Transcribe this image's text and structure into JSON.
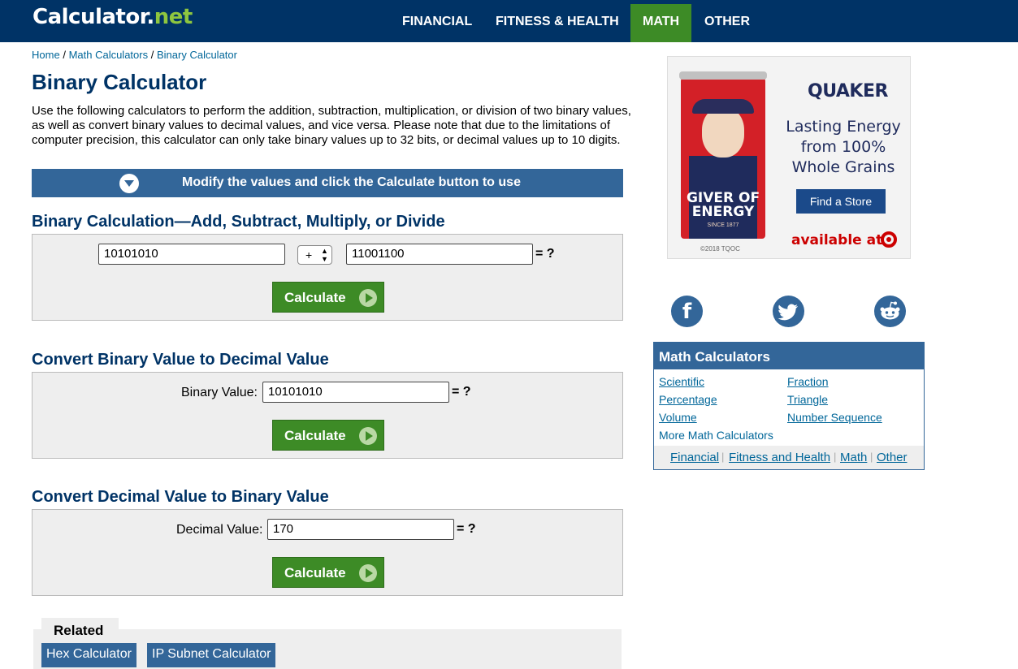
{
  "header": {
    "logo_main": "Calculator",
    "logo_dot": ".",
    "logo_net": "net",
    "nav": [
      "FINANCIAL",
      "FITNESS & HEALTH",
      "MATH",
      "OTHER"
    ],
    "active_nav": "MATH",
    "colors": {
      "bar": "#003366",
      "active": "#3d8b26"
    }
  },
  "breadcrumb": [
    "Home",
    "Math Calculators",
    "Binary Calculator"
  ],
  "breadcrumb_sep": "/",
  "page_title": "Binary Calculator",
  "intro": "Use the following calculators to perform the addition, subtraction, multiplication, or division of two binary values, as well as convert binary values to decimal values, and vice versa. Please note that due to the limitations of computer precision, this calculator can only take binary values up to 32 bits, or decimal values up to 10 digits.",
  "modify_bar": "Modify the values and click the Calculate button to use",
  "section1": {
    "title": "Binary Calculation—Add, Subtract, Multiply, or Divide",
    "value1": "10101010",
    "operator": "+",
    "value2": "11001100",
    "result": "= ?",
    "button": "Calculate"
  },
  "section2": {
    "title": "Convert Binary Value to Decimal Value",
    "label": "Binary Value:",
    "value": "10101010",
    "result": "= ?",
    "button": "Calculate"
  },
  "section3": {
    "title": "Convert Decimal Value to Binary Value",
    "label": "Decimal Value:",
    "value": "170",
    "result": "= ?",
    "button": "Calculate"
  },
  "related": {
    "title": "Related",
    "links": [
      "Hex Calculator",
      "IP Subnet Calculator"
    ]
  },
  "ad": {
    "brand": "QUAKER",
    "headline": "Lasting Energy from 100% Whole Grains",
    "can_text": "GIVER OF ENERGY",
    "since": "SINCE 1877",
    "copyright": "©2018 TQOC",
    "cta": "Find a Store",
    "available": "available at"
  },
  "social": {
    "facebook": "f",
    "twitter": "t",
    "reddit": "r"
  },
  "math_box": {
    "title": "Math Calculators",
    "links": [
      "Scientific",
      "Fraction",
      "Percentage",
      "Triangle",
      "Volume",
      "Number Sequence",
      "More Math Calculators"
    ],
    "footer": [
      "Financial",
      "Fitness and Health",
      "Math",
      "Other"
    ],
    "footer_sep": "|"
  }
}
